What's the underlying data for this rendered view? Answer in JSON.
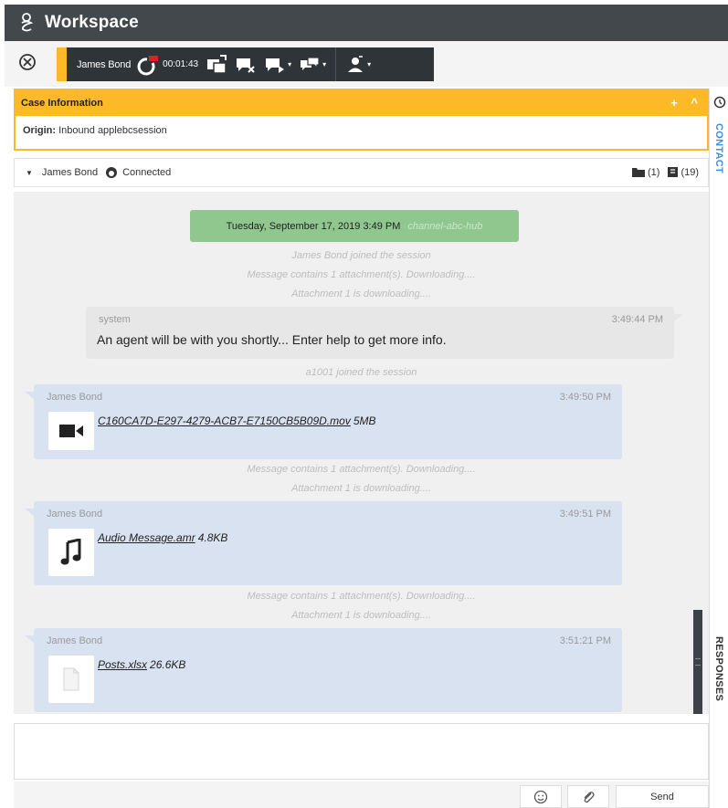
{
  "app": {
    "title": "Workspace"
  },
  "toolbar": {
    "contact_name": "James Bond",
    "timer": "00:01:43"
  },
  "case_info": {
    "title": "Case Information",
    "add_label": "+",
    "collapse_label": "^",
    "origin_label": "Origin:",
    "origin_value": "Inbound applebcsession"
  },
  "side_tabs": {
    "contact": "CONTACT",
    "responses": "RESPONSES"
  },
  "interaction": {
    "name": "James Bond",
    "status": "Connected",
    "case_count": "(1)",
    "history_count": "(19)"
  },
  "transcript": {
    "date_banner": "Tuesday, September 17, 2019 3:49 PM",
    "channel": "channel-abc-hub",
    "notices": [
      "James Bond joined the session",
      "Message contains 1 attachment(s). Downloading....",
      "Attachment 1 is downloading....",
      "a1001 joined the session",
      "Message contains 1 attachment(s). Downloading....",
      "Attachment 1 is downloading....",
      "Message contains 1 attachment(s). Downloading....",
      "Attachment 1 is downloading...."
    ],
    "system_message": {
      "sender": "system",
      "time": "3:49:44 PM",
      "text": "An agent will be with you shortly... Enter help to get more info."
    },
    "messages": [
      {
        "sender": "James Bond",
        "time": "3:49:50 PM",
        "file": "C160CA7D-E297-4279-ACB7-E7150CB5B09D.mov",
        "size": "5MB",
        "icon": "video-icon"
      },
      {
        "sender": "James Bond",
        "time": "3:49:51 PM",
        "file": "Audio Message.amr",
        "size": "4.8KB",
        "icon": "music-note-icon"
      },
      {
        "sender": "James Bond",
        "time": "3:51:21 PM",
        "file": "Posts.xlsx",
        "size": "26.6KB",
        "icon": "document-icon"
      }
    ]
  },
  "compose": {
    "send_label": "Send"
  },
  "colors": {
    "header_bg": "#43484d",
    "toolbar_bg": "#2f3438",
    "accent": "#fdb926",
    "date_banner": "#8fc78f",
    "user_bubble": "#d9e2f0",
    "system_bubble": "#e7e7e7",
    "contact_tab": "#3d8fd8"
  }
}
